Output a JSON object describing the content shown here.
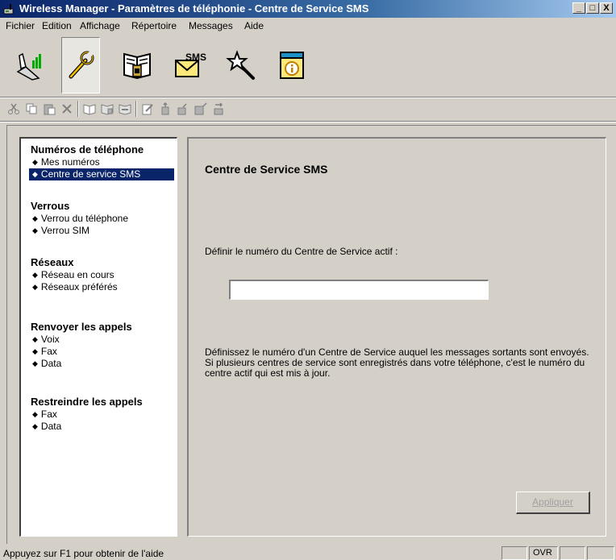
{
  "window": {
    "title": "Wireless Manager - Paramètres de téléphonie - Centre de Service SMS",
    "minimize_glyph": "_",
    "maximize_glyph": "□",
    "close_glyph": "X"
  },
  "menu": [
    "Fichier",
    "Edition",
    "Affichage",
    "Répertoire",
    "Messages",
    "Aide"
  ],
  "big_toolbar": {
    "icons": [
      "phone-connect-icon",
      "wrench-settings-icon",
      "phonebook-icon",
      "sms-envelope-icon",
      "magic-wand-icon",
      "info-panel-icon"
    ],
    "sms_text": "SMS",
    "pressed": "wrench-settings-icon"
  },
  "small_toolbar": {
    "icons": [
      "cut-icon",
      "copy-icon",
      "paste-icon",
      "delete-icon",
      "book-open-icon",
      "phonebook-copy-icon",
      "phonebook-send-icon",
      "edit-icon",
      "sim-upload-icon",
      "sim-download-icon",
      "phone-upload-icon",
      "phone-download-icon"
    ]
  },
  "nav": {
    "sections": [
      {
        "title": "Numéros de téléphone",
        "items": [
          "Mes numéros",
          "Centre de service SMS"
        ]
      },
      {
        "title": "Verrous",
        "items": [
          "Verrou du téléphone",
          "Verrou SIM"
        ]
      },
      {
        "title": "Réseaux",
        "items": [
          "Réseau en cours",
          "Réseaux préférés"
        ]
      },
      {
        "title": "Renvoyer les appels",
        "items": [
          "Voix",
          "Fax",
          "Data"
        ]
      },
      {
        "title": "Restreindre les appels",
        "items": [
          "Fax",
          "Data"
        ]
      }
    ],
    "selected": "Centre de service SMS"
  },
  "main": {
    "title": "Centre de Service SMS",
    "field_label": "Définir le numéro du Centre de Service actif :",
    "field_value": "",
    "help_text": "Définissez le numéro d'un Centre de Service auquel les messages sortants sont envoyés. Si plusieurs centres de service sont enregistrés dans votre téléphone, c'est le numéro du centre actif qui est mis à jour.",
    "apply_label": "Appliquer"
  },
  "status": {
    "text": "Appuyez sur F1 pour obtenir de l'aide",
    "ovr": "OVR"
  },
  "colors": {
    "titlebar": "#0a246a",
    "selection": "#0a246a",
    "face": "#d4d0c8"
  }
}
